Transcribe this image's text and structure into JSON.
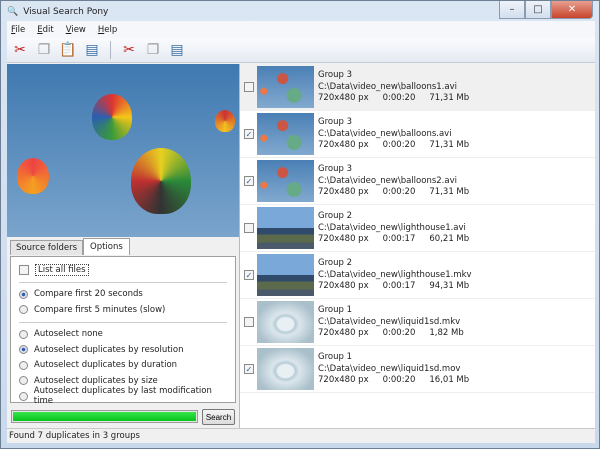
{
  "window": {
    "title": "Visual Search Pony",
    "minimize": "–",
    "maximize": "□",
    "close": "✕"
  },
  "menu": [
    {
      "key": "F",
      "rest": "ile"
    },
    {
      "key": "E",
      "rest": "dit"
    },
    {
      "key": "V",
      "rest": "iew"
    },
    {
      "key": "H",
      "rest": "elp"
    }
  ],
  "toolbar": {
    "icons": [
      "cut-icon",
      "copy-icon",
      "paste-icon",
      "save-icon",
      "cut-selected-icon",
      "copy-selected-icon",
      "save-selected-icon"
    ]
  },
  "tabs": [
    "Source folders",
    "Options"
  ],
  "options": {
    "list_all": "List all files",
    "compare": [
      "Compare first 20 seconds",
      "Compare first 5 minutes (slow)"
    ],
    "compare_selected": 0,
    "autoselect": [
      "Autoselect none",
      "Autoselect duplicates by resolution",
      "Autoselect duplicates by duration",
      "Autoselect duplicates by size",
      "Autoselect duplicates by last modification time"
    ],
    "autoselect_selected": 1
  },
  "progress": 1.0,
  "search_label": "Search",
  "status": "Found 7 duplicates in 3 groups",
  "rows": [
    {
      "group": "Group 3",
      "path": "C:\\Data\\video_new\\balloons1.avi",
      "res": "720x480 px",
      "dur": "0:00:20",
      "size": "71,31 Mb",
      "checked": false,
      "thumb": "balloons"
    },
    {
      "group": "Group 3",
      "path": "C:\\Data\\video_new\\balloons.avi",
      "res": "720x480 px",
      "dur": "0:00:20",
      "size": "71,31 Mb",
      "checked": true,
      "thumb": "balloons"
    },
    {
      "group": "Group 3",
      "path": "C:\\Data\\video_new\\balloons2.avi",
      "res": "720x480 px",
      "dur": "0:00:20",
      "size": "71,31 Mb",
      "checked": true,
      "thumb": "balloons"
    },
    {
      "group": "Group 2",
      "path": "C:\\Data\\video_new\\lighthouse1.avi",
      "res": "720x480 px",
      "dur": "0:00:17",
      "size": "60,21 Mb",
      "checked": false,
      "thumb": "lighthouse"
    },
    {
      "group": "Group 2",
      "path": "C:\\Data\\video_new\\lighthouse1.mkv",
      "res": "720x480 px",
      "dur": "0:00:17",
      "size": "94,31 Mb",
      "checked": true,
      "thumb": "lighthouse"
    },
    {
      "group": "Group 1",
      "path": "C:\\Data\\video_new\\liquid1sd.mkv",
      "res": "720x480 px",
      "dur": "0:00:20",
      "size": "1,82 Mb",
      "checked": false,
      "thumb": "liquid"
    },
    {
      "group": "Group 1",
      "path": "C:\\Data\\video_new\\liquid1sd.mov",
      "res": "720x480 px",
      "dur": "0:00:20",
      "size": "16,01 Mb",
      "checked": true,
      "thumb": "liquid"
    }
  ]
}
